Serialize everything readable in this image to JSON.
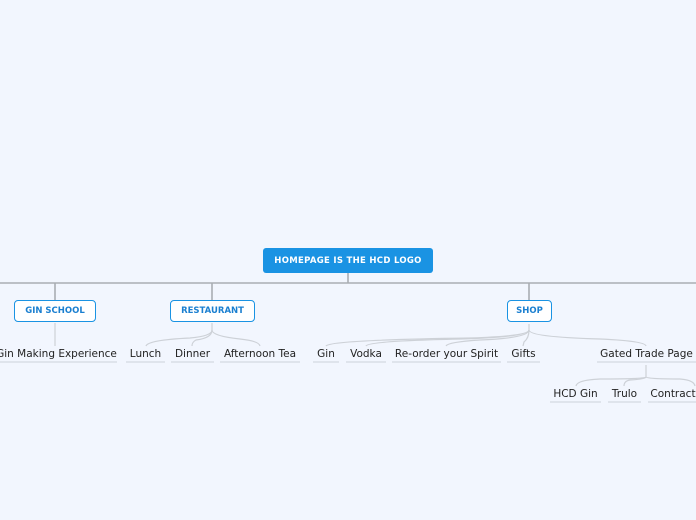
{
  "root": {
    "label": "HOMEPAGE IS THE HCD LOGO",
    "color": "#1a93e3"
  },
  "branches": [
    {
      "label": "GIN SCHOOL",
      "children": [
        "Gin Making Experience"
      ]
    },
    {
      "label": "RESTAURANT",
      "children": [
        "Lunch",
        "Dinner",
        "Afternoon Tea"
      ]
    },
    {
      "label": "SHOP",
      "children": [
        "Gin",
        "Vodka",
        "Re-order your Spirit",
        "Gifts",
        "Gated Trade Page"
      ]
    }
  ],
  "gated_trade_children": [
    "HCD Gin",
    "Trulo",
    "Contract"
  ]
}
